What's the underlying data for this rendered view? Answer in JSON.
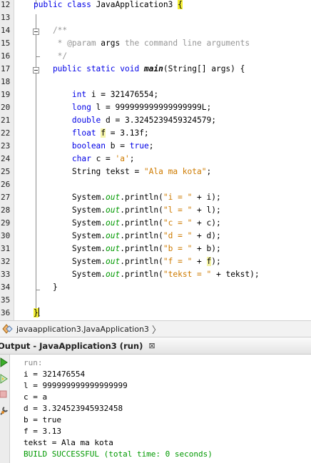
{
  "editor": {
    "lines": [
      {
        "n": "12",
        "segments": [
          {
            "t": "public class ",
            "c": "kw"
          },
          {
            "t": "JavaApplication3 ",
            "c": ""
          },
          {
            "t": "{",
            "c": "hl"
          }
        ]
      },
      {
        "n": "13",
        "segments": []
      },
      {
        "n": "14",
        "segments": [
          {
            "t": "    /**",
            "c": "cm"
          }
        ]
      },
      {
        "n": "15",
        "segments": [
          {
            "t": "     * @param ",
            "c": "cm"
          },
          {
            "t": "args",
            "c": ""
          },
          {
            "t": " the command line arguments",
            "c": "cm"
          }
        ]
      },
      {
        "n": "16",
        "segments": [
          {
            "t": "     */",
            "c": "cm"
          }
        ]
      },
      {
        "n": "17",
        "segments": [
          {
            "t": "    public static void ",
            "c": "kw"
          },
          {
            "t": "main",
            "c": "mth"
          },
          {
            "t": "(String[] args) {",
            "c": ""
          }
        ]
      },
      {
        "n": "18",
        "segments": []
      },
      {
        "n": "19",
        "segments": [
          {
            "t": "        int ",
            "c": "kw"
          },
          {
            "t": "i = 321476554;",
            "c": ""
          }
        ]
      },
      {
        "n": "20",
        "segments": [
          {
            "t": "        long ",
            "c": "kw"
          },
          {
            "t": "l = 999999999999999999L;",
            "c": ""
          }
        ]
      },
      {
        "n": "21",
        "segments": [
          {
            "t": "        double ",
            "c": "kw"
          },
          {
            "t": "d = 3.3245239459324579;",
            "c": ""
          }
        ]
      },
      {
        "n": "22",
        "segments": [
          {
            "t": "        float ",
            "c": "kw"
          },
          {
            "t": "f",
            "c": "hl-soft"
          },
          {
            "t": " = 3.13f;",
            "c": ""
          }
        ]
      },
      {
        "n": "23",
        "segments": [
          {
            "t": "        boolean ",
            "c": "kw"
          },
          {
            "t": "b = ",
            "c": ""
          },
          {
            "t": "true",
            "c": "kw"
          },
          {
            "t": ";",
            "c": ""
          }
        ]
      },
      {
        "n": "24",
        "segments": [
          {
            "t": "        char ",
            "c": "kw"
          },
          {
            "t": "c = ",
            "c": ""
          },
          {
            "t": "'a'",
            "c": "str"
          },
          {
            "t": ";",
            "c": ""
          }
        ]
      },
      {
        "n": "25",
        "segments": [
          {
            "t": "        String tekst = ",
            "c": ""
          },
          {
            "t": "\"Ala ma kota\"",
            "c": "str"
          },
          {
            "t": ";",
            "c": ""
          }
        ]
      },
      {
        "n": "26",
        "segments": []
      },
      {
        "n": "27",
        "segments": [
          {
            "t": "        System.",
            "c": ""
          },
          {
            "t": "out",
            "c": "fld"
          },
          {
            "t": ".println(",
            "c": ""
          },
          {
            "t": "\"i = \"",
            "c": "str"
          },
          {
            "t": " + i);",
            "c": ""
          }
        ]
      },
      {
        "n": "28",
        "segments": [
          {
            "t": "        System.",
            "c": ""
          },
          {
            "t": "out",
            "c": "fld"
          },
          {
            "t": ".println(",
            "c": ""
          },
          {
            "t": "\"l = \"",
            "c": "str"
          },
          {
            "t": " + l);",
            "c": ""
          }
        ]
      },
      {
        "n": "29",
        "segments": [
          {
            "t": "        System.",
            "c": ""
          },
          {
            "t": "out",
            "c": "fld"
          },
          {
            "t": ".println(",
            "c": ""
          },
          {
            "t": "\"c = \"",
            "c": "str"
          },
          {
            "t": " + c);",
            "c": ""
          }
        ]
      },
      {
        "n": "30",
        "segments": [
          {
            "t": "        System.",
            "c": ""
          },
          {
            "t": "out",
            "c": "fld"
          },
          {
            "t": ".println(",
            "c": ""
          },
          {
            "t": "\"d = \"",
            "c": "str"
          },
          {
            "t": " + d);",
            "c": ""
          }
        ]
      },
      {
        "n": "31",
        "segments": [
          {
            "t": "        System.",
            "c": ""
          },
          {
            "t": "out",
            "c": "fld"
          },
          {
            "t": ".println(",
            "c": ""
          },
          {
            "t": "\"b = \"",
            "c": "str"
          },
          {
            "t": " + b);",
            "c": ""
          }
        ]
      },
      {
        "n": "32",
        "segments": [
          {
            "t": "        System.",
            "c": ""
          },
          {
            "t": "out",
            "c": "fld"
          },
          {
            "t": ".println(",
            "c": ""
          },
          {
            "t": "\"f = \"",
            "c": "str"
          },
          {
            "t": " + ",
            "c": ""
          },
          {
            "t": "f",
            "c": "hl-soft"
          },
          {
            "t": ");",
            "c": ""
          }
        ]
      },
      {
        "n": "33",
        "segments": [
          {
            "t": "        System.",
            "c": ""
          },
          {
            "t": "out",
            "c": "fld"
          },
          {
            "t": ".println(",
            "c": ""
          },
          {
            "t": "\"tekst = \"",
            "c": "str"
          },
          {
            "t": " + tekst);",
            "c": ""
          }
        ]
      },
      {
        "n": "34",
        "segments": [
          {
            "t": "    }",
            "c": ""
          }
        ]
      },
      {
        "n": "35",
        "segments": []
      },
      {
        "n": "36",
        "segments": [
          {
            "t": "}",
            "c": "hl"
          }
        ]
      }
    ]
  },
  "breadcrumb": {
    "path": "javaapplication3.JavaApplication3",
    "chevron": "〉"
  },
  "output": {
    "tab_label": "Output - JavaApplication3 (run)",
    "close_label": "⊠",
    "lines": [
      {
        "t": "run:",
        "kind": "run"
      },
      {
        "t": "i = 321476554",
        "kind": ""
      },
      {
        "t": "l = 999999999999999999",
        "kind": ""
      },
      {
        "t": "c = a",
        "kind": ""
      },
      {
        "t": "d = 3.324523945932458",
        "kind": ""
      },
      {
        "t": "b = true",
        "kind": ""
      },
      {
        "t": "f = 3.13",
        "kind": ""
      },
      {
        "t": "tekst = Ala ma kota",
        "kind": ""
      },
      {
        "t": "BUILD SUCCESSFUL (total time: 0 seconds)",
        "kind": "build"
      }
    ]
  },
  "icons": {
    "breadcrumb_icon": "class-icon",
    "rerun": "play-icon",
    "rerun_alt": "play-outline-icon",
    "stop": "stop-icon",
    "settings": "wrench-icon"
  },
  "colors": {
    "keyword": "#0000e6",
    "comment": "#969696",
    "string": "#ce7b00",
    "field": "#009900",
    "highlight": "#f3ee32",
    "build_success": "#009900"
  }
}
